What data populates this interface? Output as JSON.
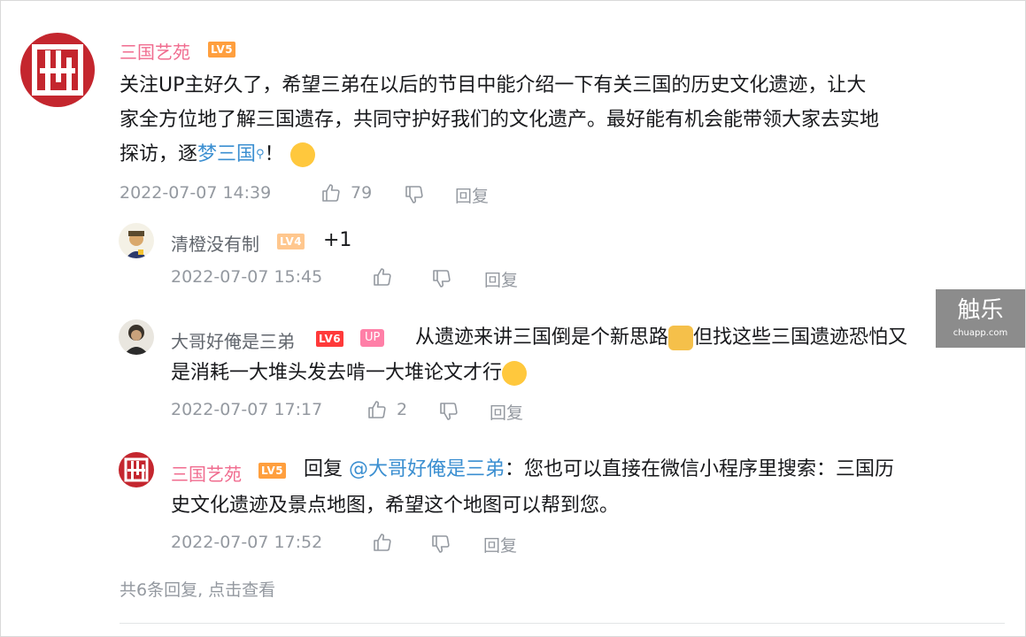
{
  "comments": [
    {
      "user": "三国艺苑",
      "level": "LV5",
      "line1": "关注UP主好久了，希望三弟在以后的节目中能介绍一下有关三国的历史文化遗迹，让大",
      "line2": "家全方位地了解三国遗存，共同守护好我们的文化遗产。最好能有机会能带领大家去实地",
      "line3_a": "探访，逐",
      "line3_link": "梦三国",
      "line3_b": "！",
      "time": "2022-07-07 14:39",
      "likes": "79",
      "reply": "回复"
    }
  ],
  "replies": [
    {
      "user": "清橙没有制",
      "level": "LV4",
      "text": "+1",
      "time": "2022-07-07 15:45",
      "likes": "",
      "reply": "回复"
    },
    {
      "user": "大哥好俺是三弟",
      "level": "LV6",
      "badge": "UP",
      "line1_a": "从遗迹来讲三国倒是个新思路",
      "line1_b": "但找这些三国遗迹恐怕又",
      "line2": "是消耗一大堆头发去啃一大堆论文才行",
      "time": "2022-07-07 17:17",
      "likes": "2",
      "reply": "回复"
    },
    {
      "user": "三国艺苑",
      "level": "LV5",
      "prefix": "回复",
      "mention": "@大哥好俺是三弟",
      "line1": "：您也可以直接在微信小程序里搜索：三国历",
      "line2": "史文化遗迹及景点地图，希望这个地图可以帮到您。",
      "time": "2022-07-07 17:52",
      "likes": "",
      "reply": "回复"
    }
  ],
  "more_replies": "共6条回复, 点击查看",
  "watermark": {
    "title": "触乐",
    "url": "chuapp.com"
  },
  "avatar_glyph": "艺",
  "colors": {
    "username_pink": "#f06c8f",
    "link_blue": "#3b8fd1",
    "meta_gray": "#9499a0"
  }
}
